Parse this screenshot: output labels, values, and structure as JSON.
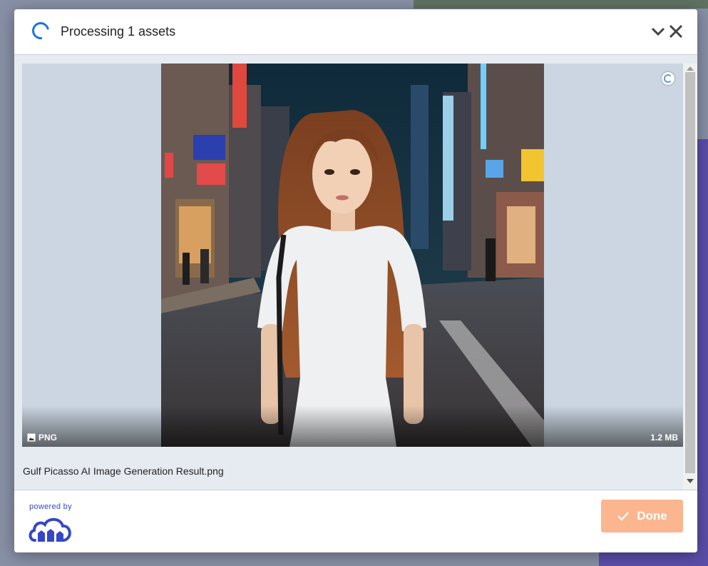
{
  "header": {
    "title": "Processing 1 assets"
  },
  "asset": {
    "format": "PNG",
    "size": "1.2 MB",
    "filename": "Gulf Picasso AI Image Generation Result.png"
  },
  "footer": {
    "powered_by": "powered by",
    "done_label": "Done"
  },
  "colors": {
    "accent_spinner": "#1a73e8",
    "done_button": "#fbb68f",
    "brand": "#3448c5"
  },
  "icons": [
    "spinner-icon",
    "chevron-down-icon",
    "close-icon",
    "image-icon",
    "checkmark-icon",
    "cloud-logo-icon"
  ]
}
